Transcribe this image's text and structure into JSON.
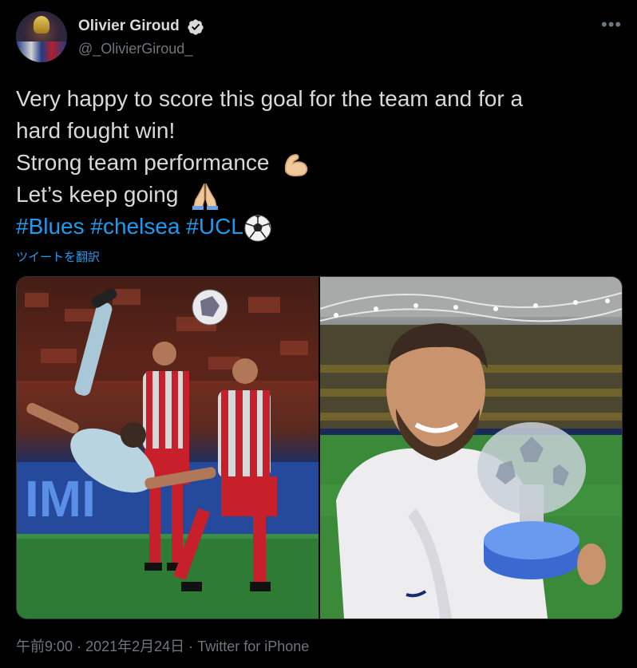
{
  "author": {
    "display_name": "Olivier Giroud",
    "handle": "@_OlivierGiroud_",
    "avatar_icon": "avatar-photo"
  },
  "tweet": {
    "line1": "Very happy to score this goal for the team and for a",
    "line2": "hard fought win!",
    "line3": "Strong team performance",
    "line4": "Let’s keep going",
    "hashtags": [
      "#Blues",
      "#chelsea",
      "#UCL"
    ],
    "emoji_icons": [
      "flexed-biceps-icon",
      "folded-hands-icon",
      "soccer-ball-icon"
    ]
  },
  "translate_label": "ツイートを翻訳",
  "media": {
    "count": 2,
    "left_photo": "bicycle-kick-photo",
    "right_photo": "selfie-with-trophy-photo"
  },
  "meta": {
    "time": "午前9:00",
    "separator": "·",
    "date": "2021年2月24日",
    "source": "Twitter for iPhone"
  },
  "colors": {
    "background": "#000000",
    "text": "#d9d9d9",
    "muted": "#6e767d",
    "link": "#1d9bf0",
    "verified": "#d9d9d9"
  }
}
